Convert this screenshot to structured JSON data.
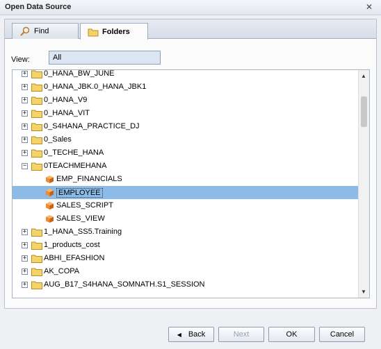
{
  "window": {
    "title": "Open Data Source",
    "close_glyph": "✕"
  },
  "tabs": [
    {
      "label": "Find",
      "icon": "search-icon",
      "active": false
    },
    {
      "label": "Folders",
      "icon": "folder-icon",
      "active": true
    }
  ],
  "view": {
    "label": "View:",
    "value": "All"
  },
  "tree": {
    "items": [
      {
        "label": "0_HANA_BW_JUNE",
        "type": "folder",
        "expander": "+",
        "depth": 0
      },
      {
        "label": "0_HANA_JBK.0_HANA_JBK1",
        "type": "folder",
        "expander": "+",
        "depth": 0
      },
      {
        "label": "0_HANA_V9",
        "type": "folder",
        "expander": "+",
        "depth": 0
      },
      {
        "label": "0_HANA_VIT",
        "type": "folder",
        "expander": "+",
        "depth": 0
      },
      {
        "label": "0_S4HANA_PRACTICE_DJ",
        "type": "folder",
        "expander": "+",
        "depth": 0
      },
      {
        "label": "0_Sales",
        "type": "folder",
        "expander": "+",
        "depth": 0
      },
      {
        "label": "0_TECHE_HANA",
        "type": "folder",
        "expander": "+",
        "depth": 0
      },
      {
        "label": "0TEACHMEHANA",
        "type": "folder",
        "expander": "−",
        "depth": 0
      },
      {
        "label": "EMP_FINANCIALS",
        "type": "cube",
        "expander": "",
        "depth": 1
      },
      {
        "label": "EMPLOYEE",
        "type": "cube",
        "expander": "",
        "depth": 1,
        "selected": true
      },
      {
        "label": "SALES_SCRIPT",
        "type": "cube",
        "expander": "",
        "depth": 1
      },
      {
        "label": "SALES_VIEW",
        "type": "cube",
        "expander": "",
        "depth": 1
      },
      {
        "label": "1_HANA_SS5.Training",
        "type": "folder",
        "expander": "+",
        "depth": 0
      },
      {
        "label": "1_products_cost",
        "type": "folder",
        "expander": "+",
        "depth": 0
      },
      {
        "label": "ABHI_EFASHION",
        "type": "folder",
        "expander": "+",
        "depth": 0
      },
      {
        "label": "AK_COPA",
        "type": "folder",
        "expander": "+",
        "depth": 0
      },
      {
        "label": "AUG_B17_S4HANA_SOMNATH.S1_SESSION",
        "type": "folder",
        "expander": "+",
        "depth": 0
      }
    ]
  },
  "buttons": {
    "back": "Back",
    "next": "Next",
    "ok": "OK",
    "cancel": "Cancel"
  },
  "colors": {
    "selection": "#8cbbe8",
    "folder": "#f3d36a",
    "cube": "#f08a2a"
  }
}
